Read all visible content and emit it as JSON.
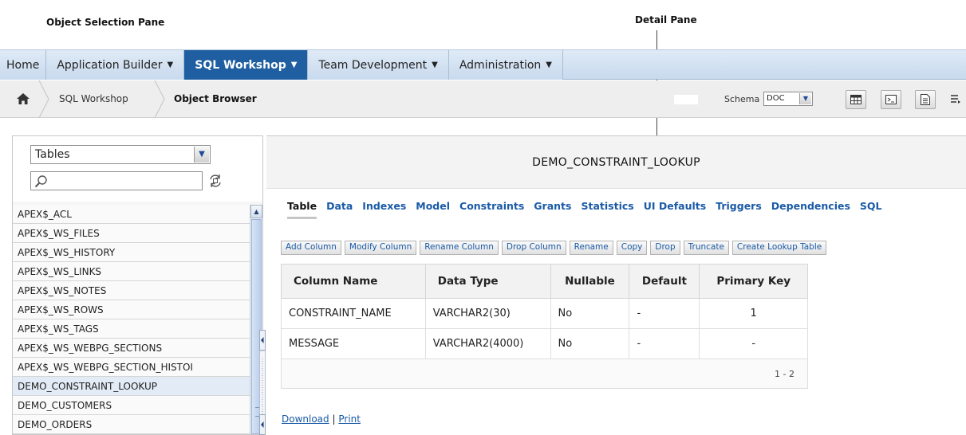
{
  "callouts": {
    "object_selection_pane": "Object Selection Pane",
    "detail_pane": "Detail Pane"
  },
  "nav": {
    "tabs": [
      {
        "label": "Home",
        "active": false
      },
      {
        "label": "Application Builder",
        "active": false
      },
      {
        "label": "SQL Workshop",
        "active": true
      },
      {
        "label": "Team Development",
        "active": false
      },
      {
        "label": "Administration",
        "active": false
      }
    ]
  },
  "breadcrumb": {
    "items": [
      "SQL Workshop",
      "Object Browser"
    ],
    "schema_label": "Schema",
    "schema_value": "DOC"
  },
  "toolbar": {
    "icons": [
      "grid-icon",
      "sql-command-icon",
      "script-document-icon",
      "more-icon"
    ]
  },
  "object_pane": {
    "type_selected": "Tables",
    "search_value": "",
    "items": [
      {
        "name": "APEX$_ACL",
        "selected": false
      },
      {
        "name": "APEX$_WS_FILES",
        "selected": false
      },
      {
        "name": "APEX$_WS_HISTORY",
        "selected": false
      },
      {
        "name": "APEX$_WS_LINKS",
        "selected": false
      },
      {
        "name": "APEX$_WS_NOTES",
        "selected": false
      },
      {
        "name": "APEX$_WS_ROWS",
        "selected": false
      },
      {
        "name": "APEX$_WS_TAGS",
        "selected": false
      },
      {
        "name": "APEX$_WS_WEBPG_SECTIONS",
        "selected": false
      },
      {
        "name": "APEX$_WS_WEBPG_SECTION_HISTOI",
        "selected": false
      },
      {
        "name": "DEMO_CONSTRAINT_LOOKUP",
        "selected": true
      },
      {
        "name": "DEMO_CUSTOMERS",
        "selected": false
      },
      {
        "name": "DEMO_ORDERS",
        "selected": false
      }
    ]
  },
  "detail": {
    "title": "DEMO_CONSTRAINT_LOOKUP",
    "tabs": [
      "Table",
      "Data",
      "Indexes",
      "Model",
      "Constraints",
      "Grants",
      "Statistics",
      "UI Defaults",
      "Triggers",
      "Dependencies",
      "SQL"
    ],
    "active_tab": "Table",
    "actions": [
      "Add Column",
      "Modify Column",
      "Rename Column",
      "Drop Column",
      "Rename",
      "Copy",
      "Drop",
      "Truncate",
      "Create Lookup Table"
    ],
    "columns": {
      "headers": [
        "Column Name",
        "Data Type",
        "Nullable",
        "Default",
        "Primary Key"
      ],
      "rows": [
        [
          "CONSTRAINT_NAME",
          "VARCHAR2(30)",
          "No",
          "-",
          "1"
        ],
        [
          "MESSAGE",
          "VARCHAR2(4000)",
          "No",
          "-",
          "-"
        ]
      ],
      "pagination": "1 - 2"
    },
    "download_label": "Download",
    "separator": "|",
    "print_label": "Print"
  },
  "colors": {
    "active_tab_bg": "#1f5ea0",
    "nav_bg": "#cfe0f1",
    "link": "#1a5aa6",
    "selected_row": "#e2ebf6"
  }
}
